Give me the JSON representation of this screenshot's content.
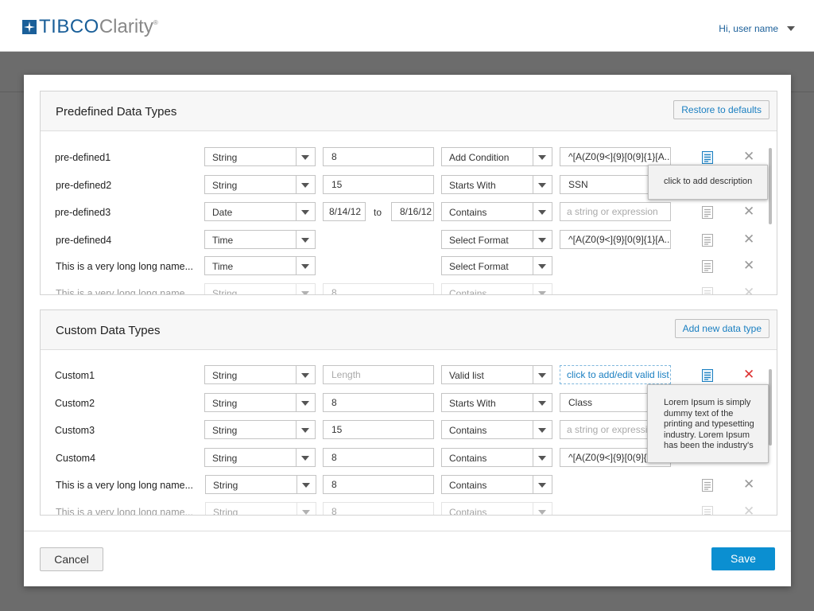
{
  "header": {
    "brand_tibco": "TIBCO",
    "brand_clarity": "Clarity",
    "brand_reg": "®",
    "user_greeting": "Hi, user name"
  },
  "predefined": {
    "title": "Predefined Data Types",
    "action": "Restore to defaults",
    "rows": [
      {
        "name": "pre-defined1",
        "type": "String",
        "value": "8",
        "condition": "Add Condition",
        "expr": "^[A(Z0(9<]{9}[0(9]{1}[A..."
      },
      {
        "name": "pre-defined2",
        "type": "String",
        "value": "15",
        "condition": "Starts With",
        "expr": "SSN"
      },
      {
        "name": "pre-defined3",
        "type": "Date",
        "date_from": "8/14/12",
        "to_label": "to",
        "date_to": "8/16/12",
        "condition": "Contains",
        "expr_placeholder": "a string or expression"
      },
      {
        "name": "pre-defined4",
        "type": "Time",
        "condition": "Select Format",
        "expr": "^[A(Z0(9<]{9}[0(9]{1}[A..."
      },
      {
        "name": "This is a very long long name...",
        "type": "Time",
        "condition": "Select Format"
      },
      {
        "name": "This is a very long long name...",
        "type": "String",
        "value": "8",
        "condition": "Contains"
      }
    ],
    "tooltip": "click to add description"
  },
  "custom": {
    "title": "Custom Data Types",
    "action": "Add new data type",
    "rows": [
      {
        "name": "Custom1",
        "type": "String",
        "value_placeholder": "Length",
        "condition": "Valid list",
        "expr": "click to add/edit valid list"
      },
      {
        "name": "Custom2",
        "type": "String",
        "value": "8",
        "condition": "Starts With",
        "expr": "Class"
      },
      {
        "name": "Custom3",
        "type": "String",
        "value": "15",
        "condition": "Contains",
        "expr_placeholder": "a string or expression"
      },
      {
        "name": "Custom4",
        "type": "String",
        "value": "8",
        "condition": "Contains",
        "expr": "^[A(Z0(9<]{9}[0(9]{1}[A..."
      },
      {
        "name": "This is a very long long name...",
        "type": "String",
        "value": "8",
        "condition": "Contains"
      },
      {
        "name": "This is a very long long name...",
        "type": "String",
        "value": "8",
        "condition": "Contains"
      }
    ],
    "tooltip": "Lorem Ipsum is simply dummy text of the printing and typesetting industry. Lorem Ipsum has been the industry's"
  },
  "footer": {
    "cancel_label": "Cancel",
    "save_label": "Save"
  },
  "colors": {
    "brand": "#1a5f99",
    "link": "#1a7fc1",
    "primary_button": "#0b8fd1",
    "delete_active": "#d33333",
    "overlay": "#6c6c6c"
  },
  "icons": [
    "tibco-logo-icon",
    "chevron-down-icon",
    "description-icon",
    "close-icon"
  ]
}
